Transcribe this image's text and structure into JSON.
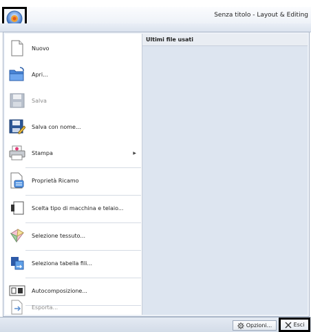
{
  "window": {
    "title": "Senza titolo - Layout & Editing"
  },
  "menu": {
    "items": [
      {
        "label": "Nuovo",
        "icon": "new-document-icon",
        "enabled": true
      },
      {
        "label": "Apri...",
        "icon": "open-folder-icon",
        "enabled": true
      },
      {
        "label": "Salva",
        "icon": "save-disk-icon",
        "enabled": false
      },
      {
        "label": "Salva con nome...",
        "icon": "save-as-icon",
        "enabled": true
      },
      {
        "label": "Stampa",
        "icon": "print-icon",
        "enabled": true,
        "submenu": true
      },
      {
        "label": "Proprietà Ricamo",
        "icon": "embroidery-properties-icon",
        "enabled": true
      },
      {
        "label": "Scelta tipo di macchina e telaio...",
        "icon": "machine-hoop-icon",
        "enabled": true
      },
      {
        "label": "Selezione tessuto...",
        "icon": "fabric-icon",
        "enabled": true
      },
      {
        "label": "Seleziona tabella fili...",
        "icon": "thread-table-icon",
        "enabled": true
      },
      {
        "label": "Autocomposizione...",
        "icon": "auto-compose-icon",
        "enabled": true
      },
      {
        "label": "Esporta...",
        "icon": "export-icon",
        "enabled": false
      }
    ]
  },
  "recent": {
    "header": "Ultimi file usati"
  },
  "footer": {
    "options_label": "Opzioni...",
    "exit_label": "Esci"
  },
  "colors": {
    "panel_bg": "#dde5f0",
    "accent": "#2a6fd4"
  }
}
